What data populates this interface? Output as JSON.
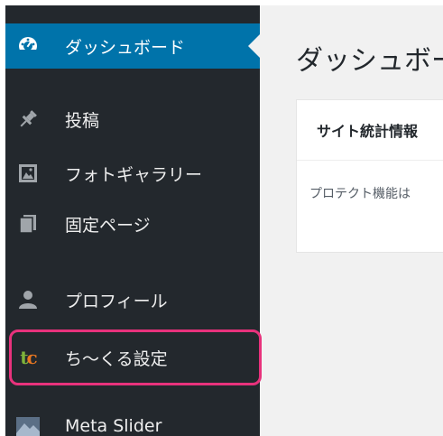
{
  "sidebar": {
    "items": [
      {
        "label": "ダッシュボード",
        "icon": "dashboard-icon",
        "active": true
      },
      {
        "label": "投稿",
        "icon": "pin-icon"
      },
      {
        "label": "フォトギャラリー",
        "icon": "gallery-icon"
      },
      {
        "label": "固定ページ",
        "icon": "pages-icon"
      },
      {
        "label": "プロフィール",
        "icon": "user-icon"
      },
      {
        "label": "ち〜くる設定",
        "icon": "tc-logo-icon",
        "highlighted": true
      },
      {
        "label": "Meta Slider",
        "icon": "meta-slider-icon"
      }
    ],
    "logo_text": "tc"
  },
  "main": {
    "title": "ダッシュボー",
    "card": {
      "title": "サイト統計情報",
      "body": "プロテクト機能は"
    }
  },
  "colors": {
    "sidebar_bg": "#23282d",
    "active_bg": "#0073aa",
    "highlight_border": "#e8327c",
    "main_bg": "#f1f1f1"
  }
}
